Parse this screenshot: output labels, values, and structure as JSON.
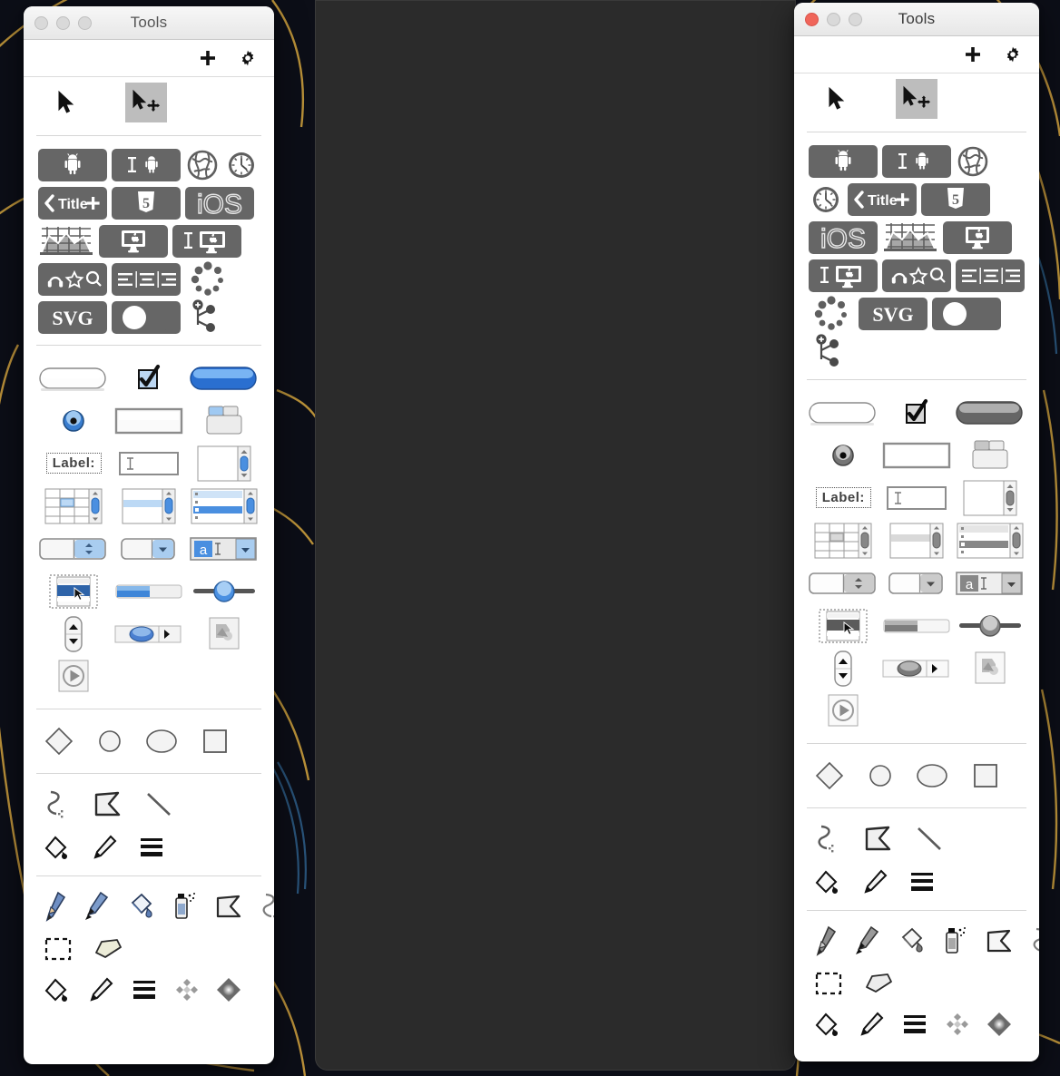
{
  "desktop": {
    "background_color": "#0c0e17",
    "accent_line_color": "#c89b3c",
    "secondary_line_color": "#2e5f8a",
    "center_panel_color": "#2b2b2b"
  },
  "windows": [
    {
      "id": "left",
      "title": "Tools",
      "active": false,
      "traffic_lights": [
        {
          "name": "close",
          "color": "#d9d9d9"
        },
        {
          "name": "minimize",
          "color": "#d9d9d9"
        },
        {
          "name": "zoom",
          "color": "#d9d9d9"
        }
      ]
    },
    {
      "id": "right",
      "title": "Tools",
      "active": true,
      "traffic_lights": [
        {
          "name": "close",
          "color": "#f0655a"
        },
        {
          "name": "minimize",
          "color": "#d9d9d9"
        },
        {
          "name": "zoom",
          "color": "#d9d9d9"
        }
      ]
    }
  ],
  "toolbar": {
    "add_label": "+",
    "add_icon": "plus-icon",
    "settings_icon": "gear-icon"
  },
  "sections": {
    "pointers": {
      "items": [
        {
          "name": "arrow-pointer-tool",
          "label": "Arrow",
          "selected": false
        },
        {
          "name": "move-pointer-tool",
          "label": "Move",
          "selected": true
        }
      ]
    },
    "platform_icons": {
      "items": [
        {
          "name": "android-device-icon",
          "label": "Android",
          "tile": "wide"
        },
        {
          "name": "android-text-field-icon",
          "label": "Android Text Field",
          "tile": "wide"
        },
        {
          "name": "globe-web-icon",
          "label": "Web",
          "tile": "plain"
        },
        {
          "name": "clock-icon",
          "label": "Clock",
          "tile": "plain"
        },
        {
          "name": "title-bar-icon",
          "label": "Title",
          "tile": "wide",
          "text": "Title"
        },
        {
          "name": "html5-icon",
          "label": "HTML5",
          "tile": "wide",
          "text": "5"
        },
        {
          "name": "ios-icon",
          "label": "iOS",
          "tile": "wide",
          "text": "iOS"
        },
        {
          "name": "chart-icon",
          "label": "Chart",
          "tile": "plain"
        },
        {
          "name": "mac-display-icon",
          "label": "Mac Display",
          "tile": "wide"
        },
        {
          "name": "mac-text-field-icon",
          "label": "Mac Text Field",
          "tile": "wide"
        },
        {
          "name": "media-controls-icon",
          "label": "Media Controls",
          "tile": "wide"
        },
        {
          "name": "text-align-icon",
          "label": "Text Align",
          "tile": "wide"
        },
        {
          "name": "spinner-icon",
          "label": "Spinner",
          "tile": "plain"
        },
        {
          "name": "svg-icon",
          "label": "SVG",
          "tile": "wide",
          "text": "SVG"
        },
        {
          "name": "toggle-switch-icon",
          "label": "Toggle",
          "tile": "wide"
        },
        {
          "name": "node-tree-icon",
          "label": "Node Tree",
          "tile": "plain"
        }
      ]
    },
    "widgets": {
      "items": [
        {
          "name": "push-button-widget",
          "label": "Push Button"
        },
        {
          "name": "checkbox-widget",
          "label": "Checkbox"
        },
        {
          "name": "default-button-widget",
          "label": "Default Button"
        },
        {
          "name": "radio-button-widget",
          "label": "Radio Button"
        },
        {
          "name": "group-box-widget",
          "label": "Group Box"
        },
        {
          "name": "tab-view-widget",
          "label": "Tab View"
        },
        {
          "name": "label-widget",
          "label": "Label:",
          "text": "Label:"
        },
        {
          "name": "text-field-widget",
          "label": "Text Field"
        },
        {
          "name": "scroll-view-widget",
          "label": "Scroll View"
        },
        {
          "name": "table-view-widget",
          "label": "Table View"
        },
        {
          "name": "list-view-widget",
          "label": "List View"
        },
        {
          "name": "outline-view-widget",
          "label": "Outline View"
        },
        {
          "name": "stepper-field-widget",
          "label": "Stepper Field"
        },
        {
          "name": "popup-button-widget",
          "label": "Popup Button"
        },
        {
          "name": "combo-box-widget",
          "label": "Combo Box",
          "text": "a"
        },
        {
          "name": "selection-widget",
          "label": "Selection"
        },
        {
          "name": "progress-bar-widget",
          "label": "Progress Bar"
        },
        {
          "name": "slider-widget",
          "label": "Slider"
        },
        {
          "name": "stepper-widget",
          "label": "Stepper"
        },
        {
          "name": "scrollbar-widget",
          "label": "Scrollbar"
        },
        {
          "name": "image-well-widget",
          "label": "Image Well"
        },
        {
          "name": "play-button-widget",
          "label": "Play Button"
        }
      ]
    },
    "shapes": {
      "items": [
        {
          "name": "diamond-shape-tool",
          "label": "Diamond"
        },
        {
          "name": "circle-shape-tool",
          "label": "Circle"
        },
        {
          "name": "ellipse-shape-tool",
          "label": "Ellipse"
        },
        {
          "name": "rectangle-shape-tool",
          "label": "Rectangle"
        }
      ]
    },
    "vector_tools": {
      "items": [
        {
          "name": "bezier-curve-tool",
          "label": "Bezier Curve"
        },
        {
          "name": "polygon-tool",
          "label": "Polygon"
        },
        {
          "name": "line-tool",
          "label": "Line"
        }
      ]
    },
    "vector_style_tools": {
      "items": [
        {
          "name": "fill-color-tool",
          "label": "Fill Color"
        },
        {
          "name": "stroke-color-tool",
          "label": "Stroke Color"
        },
        {
          "name": "stroke-width-tool",
          "label": "Stroke Width"
        }
      ]
    },
    "paint_tools": {
      "items": [
        {
          "name": "pencil-tool",
          "label": "Pencil"
        },
        {
          "name": "paintbrush-tool",
          "label": "Paintbrush"
        },
        {
          "name": "paint-bucket-tool",
          "label": "Paint Bucket"
        },
        {
          "name": "spray-can-tool",
          "label": "Spray Can"
        },
        {
          "name": "polygon-paint-tool",
          "label": "Polygon"
        },
        {
          "name": "bezier-paint-tool",
          "label": "Bezier"
        }
      ]
    },
    "select_tools": {
      "items": [
        {
          "name": "marquee-select-tool",
          "label": "Marquee Select"
        },
        {
          "name": "eraser-tool",
          "label": "Eraser"
        }
      ]
    },
    "paint_style_tools": {
      "items": [
        {
          "name": "fill-color-tool",
          "label": "Fill Color"
        },
        {
          "name": "stroke-color-tool",
          "label": "Stroke Color"
        },
        {
          "name": "stroke-width-tool",
          "label": "Stroke Width"
        },
        {
          "name": "pattern-tool",
          "label": "Pattern"
        },
        {
          "name": "gradient-tool",
          "label": "Gradient"
        }
      ]
    }
  }
}
